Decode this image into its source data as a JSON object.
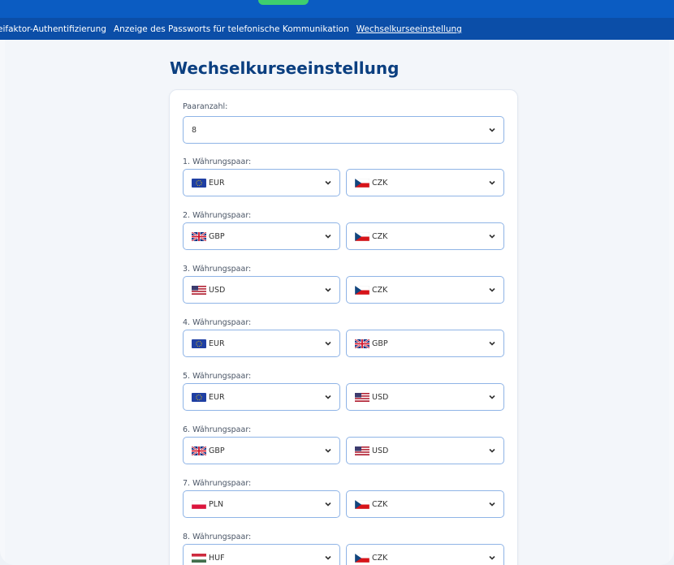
{
  "nav": {
    "items": [
      {
        "label": "eifaktor-Authentifizierung",
        "active": false
      },
      {
        "label": "Anzeige des Passworts für telefonische Kommunikation",
        "active": false
      },
      {
        "label": "Wechselkurseeinstellung",
        "active": true
      }
    ]
  },
  "page": {
    "title": "Wechselkurseeinstellung"
  },
  "form": {
    "pair_count_label": "Paaranzahl:",
    "pair_count_value": "8",
    "pairs": [
      {
        "label": "1. Währungspaar:",
        "from": {
          "code": "EUR",
          "flag": "eu-flag-icon"
        },
        "to": {
          "code": "CZK",
          "flag": "cz-flag-icon"
        }
      },
      {
        "label": "2. Währungspaar:",
        "from": {
          "code": "GBP",
          "flag": "uk-flag-icon"
        },
        "to": {
          "code": "CZK",
          "flag": "cz-flag-icon"
        }
      },
      {
        "label": "3. Währungspaar:",
        "from": {
          "code": "USD",
          "flag": "us-flag-icon"
        },
        "to": {
          "code": "CZK",
          "flag": "cz-flag-icon"
        }
      },
      {
        "label": "4. Währungspaar:",
        "from": {
          "code": "EUR",
          "flag": "eu-flag-icon"
        },
        "to": {
          "code": "GBP",
          "flag": "uk-flag-icon"
        }
      },
      {
        "label": "5. Währungspaar:",
        "from": {
          "code": "EUR",
          "flag": "eu-flag-icon"
        },
        "to": {
          "code": "USD",
          "flag": "us-flag-icon"
        }
      },
      {
        "label": "6. Währungspaar:",
        "from": {
          "code": "GBP",
          "flag": "uk-flag-icon"
        },
        "to": {
          "code": "USD",
          "flag": "us-flag-icon"
        }
      },
      {
        "label": "7. Währungspaar:",
        "from": {
          "code": "PLN",
          "flag": "pl-flag-icon"
        },
        "to": {
          "code": "CZK",
          "flag": "cz-flag-icon"
        }
      },
      {
        "label": "8. Währungspaar:",
        "from": {
          "code": "HUF",
          "flag": "hu-flag-icon"
        },
        "to": {
          "code": "CZK",
          "flag": "cz-flag-icon"
        }
      }
    ]
  },
  "colors": {
    "nav_bg": "#0b4ea8",
    "topbar_bg": "#0b5cc2",
    "title": "#0b3f80",
    "select_border": "#8fb4e6"
  }
}
